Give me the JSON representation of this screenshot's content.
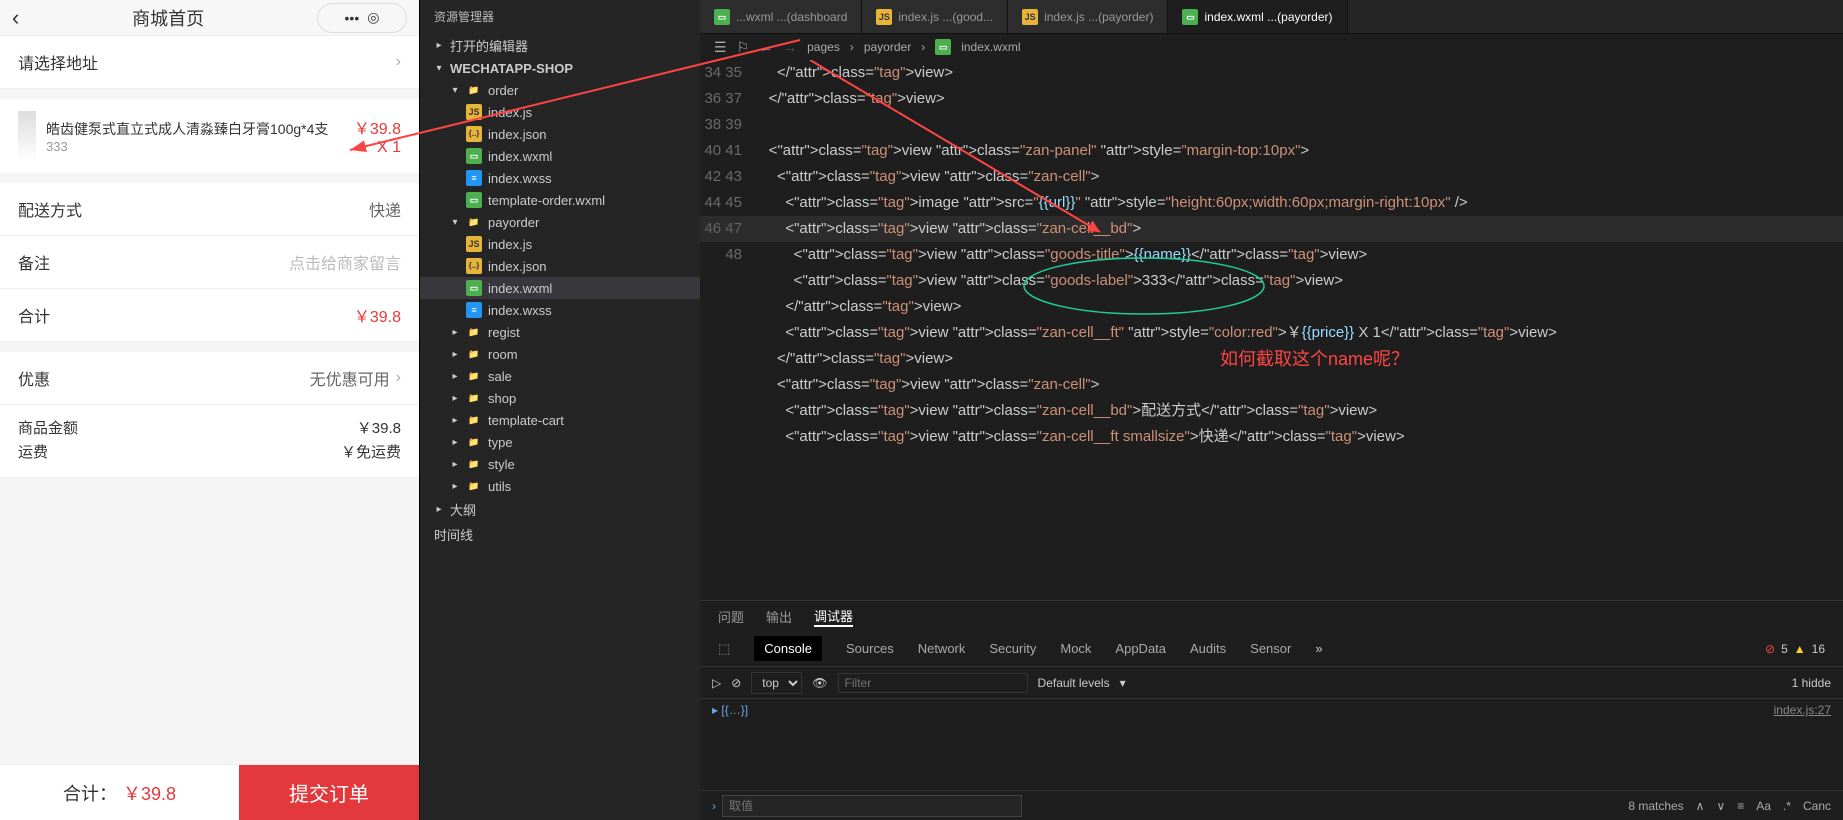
{
  "phone": {
    "title": "商城首页",
    "address_hint": "请选择地址",
    "goods": {
      "name": "皓齿健泵式直立式成人清淼臻白牙膏100g*4支",
      "sub": "333",
      "price": "￥39.8",
      "qty": "X 1"
    },
    "delivery_label": "配送方式",
    "delivery_val": "快递",
    "remark_label": "备注",
    "remark_placeholder": "点击给商家留言",
    "total_label": "合计",
    "total_val": "￥39.8",
    "discount_label": "优惠",
    "discount_val": "无优惠可用",
    "amount_label": "商品金额",
    "amount_val": "￥39.8",
    "ship_label": "运费",
    "ship_val": "￥免运费",
    "footer_total_label": "合计：",
    "footer_total": "￥39.8",
    "submit": "提交订单"
  },
  "explorer": {
    "title": "资源管理器",
    "section1": "打开的编辑器",
    "root": "WECHATAPP-SHOP",
    "folders": {
      "order": "order",
      "payorder": "payorder",
      "regist": "regist",
      "room": "room",
      "sale": "sale",
      "shop": "shop",
      "template_cart": "template-cart",
      "type": "type",
      "style": "style",
      "utils": "utils"
    },
    "files": {
      "indexjs": "index.js",
      "indexjson": "index.json",
      "indexwxml": "index.wxml",
      "indexwxss": "index.wxss",
      "template_order": "template-order.wxml"
    },
    "outline": "大纲",
    "timeline": "时间线"
  },
  "editor": {
    "tabs": [
      {
        "label": "...wxml ...(dashboard",
        "ico": "wxml"
      },
      {
        "label": "index.js ...(good...",
        "ico": "js"
      },
      {
        "label": "index.js ...(payorder)",
        "ico": "js"
      },
      {
        "label": "index.wxml ...(payorder)",
        "ico": "wxml",
        "active": true
      }
    ],
    "breadcrumb": [
      "pages",
      "payorder",
      "index.wxml"
    ],
    "line_start": 34,
    "code_lines": [
      "      </view>",
      "    </view>",
      "",
      "    <view class=\"zan-panel\" style=\"margin-top:10px\">",
      "      <view class=\"zan-cell\">",
      "        <image src=\"{{url}}\" style=\"height:60px;width:60px;margin-right:10px\" />",
      "        <view class=\"zan-cell__bd\">",
      "          <view class=\"goods-title\">{{name}}</view>",
      "          <view class=\"goods-label\">333</view>",
      "        </view>",
      "        <view class=\"zan-cell__ft\" style=\"color:red\">￥{{price}} X 1</view>",
      "      </view>",
      "      <view class=\"zan-cell\">",
      "        <view class=\"zan-cell__bd\">配送方式</view>",
      "        <view class=\"zan-cell__ft smallsize\">快递</view>"
    ],
    "annotation": "如何截取这个name呢？"
  },
  "bottom": {
    "btabs": [
      "问题",
      "输出",
      "调试器"
    ],
    "dtabs": [
      "Console",
      "Sources",
      "Network",
      "Security",
      "Mock",
      "AppData",
      "Audits",
      "Sensor"
    ],
    "err_count": "5",
    "warn_count": "16",
    "ctx": "top",
    "filter_ph": "Filter",
    "levels": "Default levels",
    "matches": "8 matches",
    "hidden": "1 hidde",
    "log_line": "▸ [{…}]",
    "log_src": "index.js:27",
    "status_ph": "取值",
    "cancel": "Canc"
  }
}
